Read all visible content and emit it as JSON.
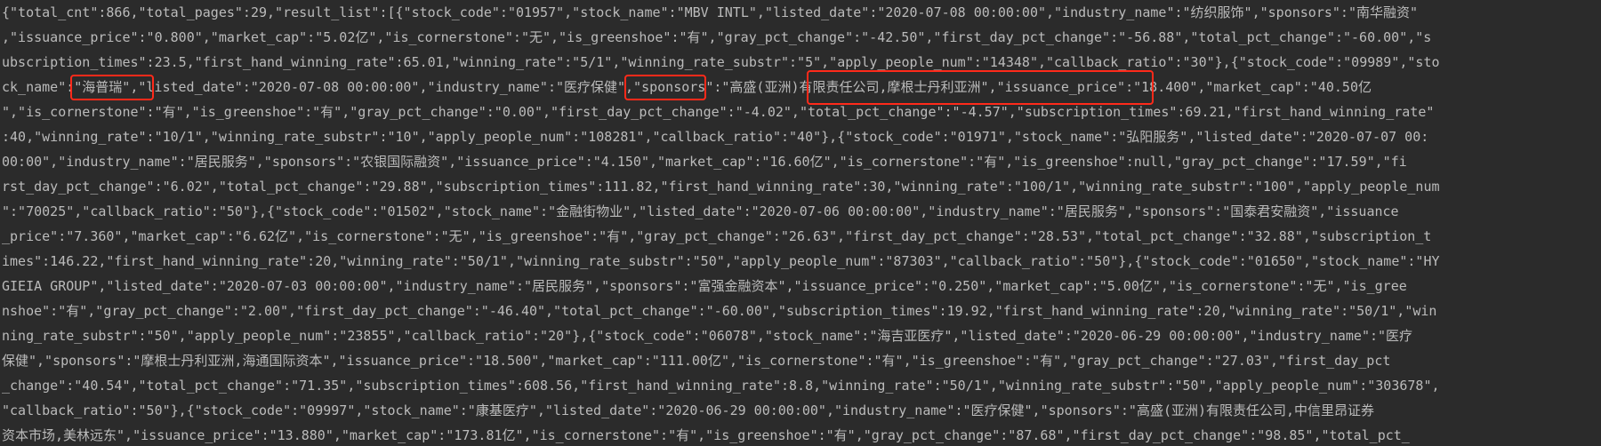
{
  "output": {
    "lines": [
      "{\"total_cnt\":866,\"total_pages\":29,\"result_list\":[{\"stock_code\":\"01957\",\"stock_name\":\"MBV INTL\",\"listed_date\":\"2020-07-08 00:00:00\",\"industry_name\":\"纺织服饰\",\"sponsors\":\"南华融资\"",
      ",\"issuance_price\":\"0.800\",\"market_cap\":\"5.02亿\",\"is_cornerstone\":\"无\",\"is_greenshoe\":\"有\",\"gray_pct_change\":\"-42.50\",\"first_day_pct_change\":\"-56.88\",\"total_pct_change\":\"-60.00\",\"s",
      "ubscription_times\":23.5,\"first_hand_winning_rate\":65.01,\"winning_rate\":\"5/1\",\"winning_rate_substr\":\"5\",\"apply_people_num\":\"14348\",\"callback_ratio\":\"30\"},{\"stock_code\":\"09989\",\"sto",
      "ck_name\":\"海普瑞\",\"listed_date\":\"2020-07-08 00:00:00\",\"industry_name\":\"医疗保健\",\"sponsors\":\"高盛(亚洲)有限责任公司,摩根士丹利亚洲\",\"issuance_price\":\"18.400\",\"market_cap\":\"40.50亿",
      "\",\"is_cornerstone\":\"有\",\"is_greenshoe\":\"有\",\"gray_pct_change\":\"0.00\",\"first_day_pct_change\":\"-4.02\",\"total_pct_change\":\"-4.57\",\"subscription_times\":69.21,\"first_hand_winning_rate\"",
      ":40,\"winning_rate\":\"10/1\",\"winning_rate_substr\":\"10\",\"apply_people_num\":\"108281\",\"callback_ratio\":\"40\"},{\"stock_code\":\"01971\",\"stock_name\":\"弘阳服务\",\"listed_date\":\"2020-07-07 00:",
      "00:00\",\"industry_name\":\"居民服务\",\"sponsors\":\"农银国际融资\",\"issuance_price\":\"4.150\",\"market_cap\":\"16.60亿\",\"is_cornerstone\":\"有\",\"is_greenshoe\":null,\"gray_pct_change\":\"17.59\",\"fi",
      "rst_day_pct_change\":\"6.02\",\"total_pct_change\":\"29.88\",\"subscription_times\":111.82,\"first_hand_winning_rate\":30,\"winning_rate\":\"100/1\",\"winning_rate_substr\":\"100\",\"apply_people_num",
      "\":\"70025\",\"callback_ratio\":\"50\"},{\"stock_code\":\"01502\",\"stock_name\":\"金融街物业\",\"listed_date\":\"2020-07-06 00:00:00\",\"industry_name\":\"居民服务\",\"sponsors\":\"国泰君安融资\",\"issuance",
      "_price\":\"7.360\",\"market_cap\":\"6.62亿\",\"is_cornerstone\":\"无\",\"is_greenshoe\":\"有\",\"gray_pct_change\":\"26.63\",\"first_day_pct_change\":\"28.53\",\"total_pct_change\":\"32.88\",\"subscription_t",
      "imes\":146.22,\"first_hand_winning_rate\":20,\"winning_rate\":\"50/1\",\"winning_rate_substr\":\"50\",\"apply_people_num\":\"87303\",\"callback_ratio\":\"50\"},{\"stock_code\":\"01650\",\"stock_name\":\"HY",
      "GIEIA GROUP\",\"listed_date\":\"2020-07-03 00:00:00\",\"industry_name\":\"居民服务\",\"sponsors\":\"富强金融资本\",\"issuance_price\":\"0.250\",\"market_cap\":\"5.00亿\",\"is_cornerstone\":\"无\",\"is_gree",
      "nshoe\":\"有\",\"gray_pct_change\":\"2.00\",\"first_day_pct_change\":\"-46.40\",\"total_pct_change\":\"-60.00\",\"subscription_times\":19.92,\"first_hand_winning_rate\":20,\"winning_rate\":\"50/1\",\"win",
      "ning_rate_substr\":\"50\",\"apply_people_num\":\"23855\",\"callback_ratio\":\"20\"},{\"stock_code\":\"06078\",\"stock_name\":\"海吉亚医疗\",\"listed_date\":\"2020-06-29 00:00:00\",\"industry_name\":\"医疗",
      "保健\",\"sponsors\":\"摩根士丹利亚洲,海通国际资本\",\"issuance_price\":\"18.500\",\"market_cap\":\"111.00亿\",\"is_cornerstone\":\"有\",\"is_greenshoe\":\"有\",\"gray_pct_change\":\"27.03\",\"first_day_pct",
      "_change\":\"40.54\",\"total_pct_change\":\"71.35\",\"subscription_times\":608.56,\"first_hand_winning_rate\":8.8,\"winning_rate\":\"50/1\",\"winning_rate_substr\":\"50\",\"apply_people_num\":\"303678\",",
      "\"callback_ratio\":\"50\"},{\"stock_code\":\"09997\",\"stock_name\":\"康基医疗\",\"listed_date\":\"2020-06-29 00:00:00\",\"industry_name\":\"医疗保健\",\"sponsors\":\"高盛(亚洲)有限责任公司,中信里昂证券",
      "资本市场,美林远东\",\"issuance_price\":\"13.880\",\"market_cap\":\"173.81亿\",\"is_cornerstone\":\"有\",\"is_greenshoe\":\"有\",\"gray_pct_change\":\"87.68\",\"first_day_pct_change\":\"98.85\",\"total_pct_"
    ]
  },
  "colors": {
    "background": "#2b2b2b",
    "text": "#bbbbbb",
    "highlight": "#ff2a1a"
  }
}
